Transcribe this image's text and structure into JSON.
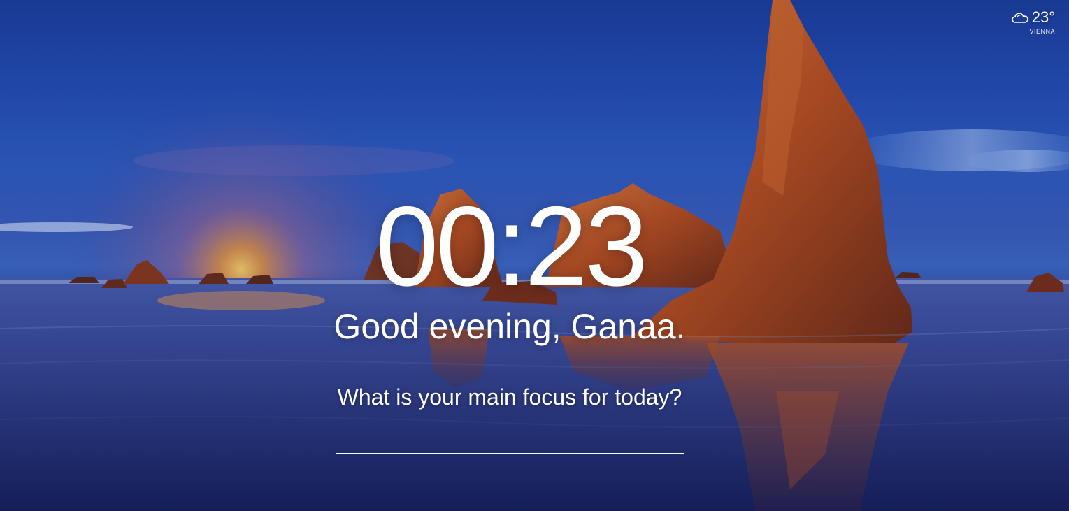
{
  "weather": {
    "icon": "cloud-icon",
    "temperature": "23°",
    "city": "VIENNA"
  },
  "clock": {
    "time": "00:23"
  },
  "greeting": {
    "text": "Good evening, Ganaa."
  },
  "focus": {
    "question": "What is your main focus for today?",
    "value": "",
    "placeholder": ""
  },
  "colors": {
    "sky": "#2f5ec4",
    "sunset": "#f0a040",
    "rock": "#c0541f",
    "water": "#22367e",
    "text": "#ffffff"
  }
}
